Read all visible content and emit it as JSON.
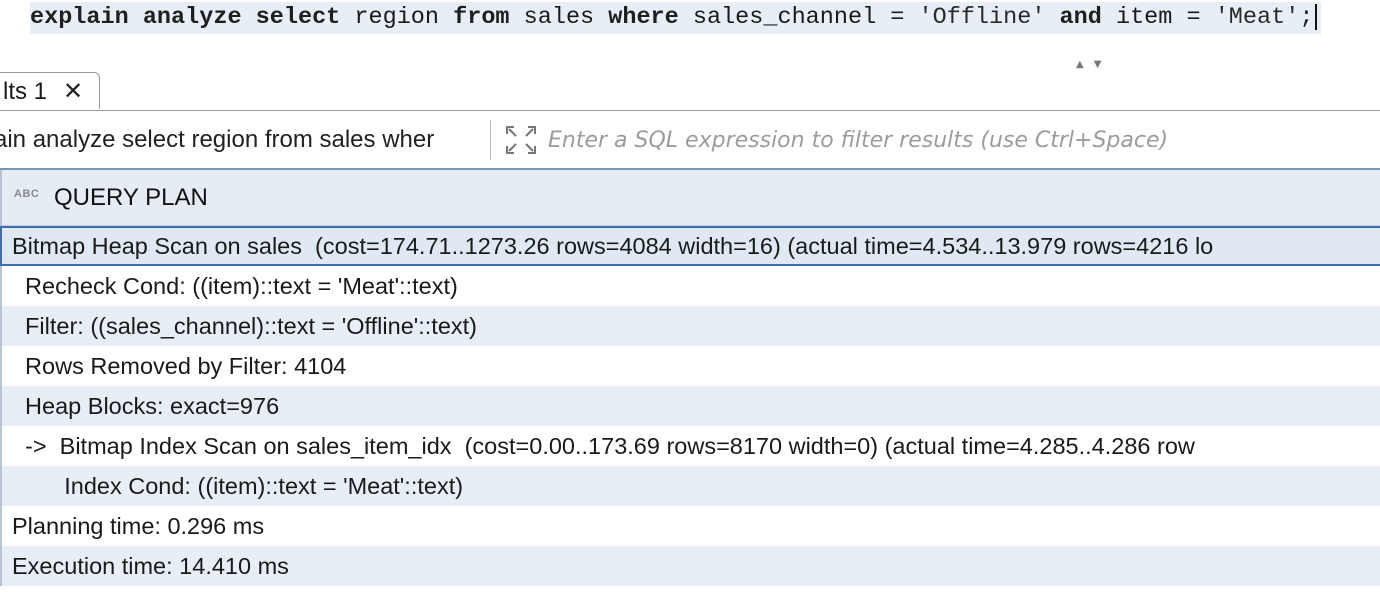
{
  "editor": {
    "sql_tokens": [
      {
        "text": "explain",
        "type": "kw"
      },
      {
        "text": " ",
        "type": "plain"
      },
      {
        "text": "analyze",
        "type": "kw"
      },
      {
        "text": " ",
        "type": "plain"
      },
      {
        "text": "select",
        "type": "kw"
      },
      {
        "text": " region ",
        "type": "plain"
      },
      {
        "text": "from",
        "type": "kw"
      },
      {
        "text": " sales ",
        "type": "plain"
      },
      {
        "text": "where",
        "type": "kw"
      },
      {
        "text": " sales_channel = ",
        "type": "plain"
      },
      {
        "text": "'Offline'",
        "type": "str"
      },
      {
        "text": " ",
        "type": "plain"
      },
      {
        "text": "and",
        "type": "kw"
      },
      {
        "text": " item = ",
        "type": "plain"
      },
      {
        "text": "'Meat'",
        "type": "str"
      },
      {
        "text": ";",
        "type": "plain"
      }
    ]
  },
  "tabs": {
    "results_tab_label": "lts 1",
    "close_glyph": "✕"
  },
  "sort_arrows": "▲▼",
  "filter": {
    "query_text": "ain analyze select region from sales wher",
    "placeholder": "Enter a SQL expression to filter results (use Ctrl+Space)"
  },
  "grid": {
    "type_badge": "ABC",
    "column_header": "QUERY PLAN",
    "rows": [
      "Bitmap Heap Scan on sales  (cost=174.71..1273.26 rows=4084 width=16) (actual time=4.534..13.979 rows=4216 lo",
      "  Recheck Cond: ((item)::text = 'Meat'::text)",
      "  Filter: ((sales_channel)::text = 'Offline'::text)",
      "  Rows Removed by Filter: 4104",
      "  Heap Blocks: exact=976",
      "  ->  Bitmap Index Scan on sales_item_idx  (cost=0.00..173.69 rows=8170 width=0) (actual time=4.285..4.286 row",
      "        Index Cond: ((item)::text = 'Meat'::text)",
      "Planning time: 0.296 ms",
      "Execution time: 14.410 ms"
    ]
  },
  "colors": {
    "row_alt": "#e8eef6",
    "selection_border": "#3d6fb0",
    "header_bg": "#e6ecf4"
  }
}
